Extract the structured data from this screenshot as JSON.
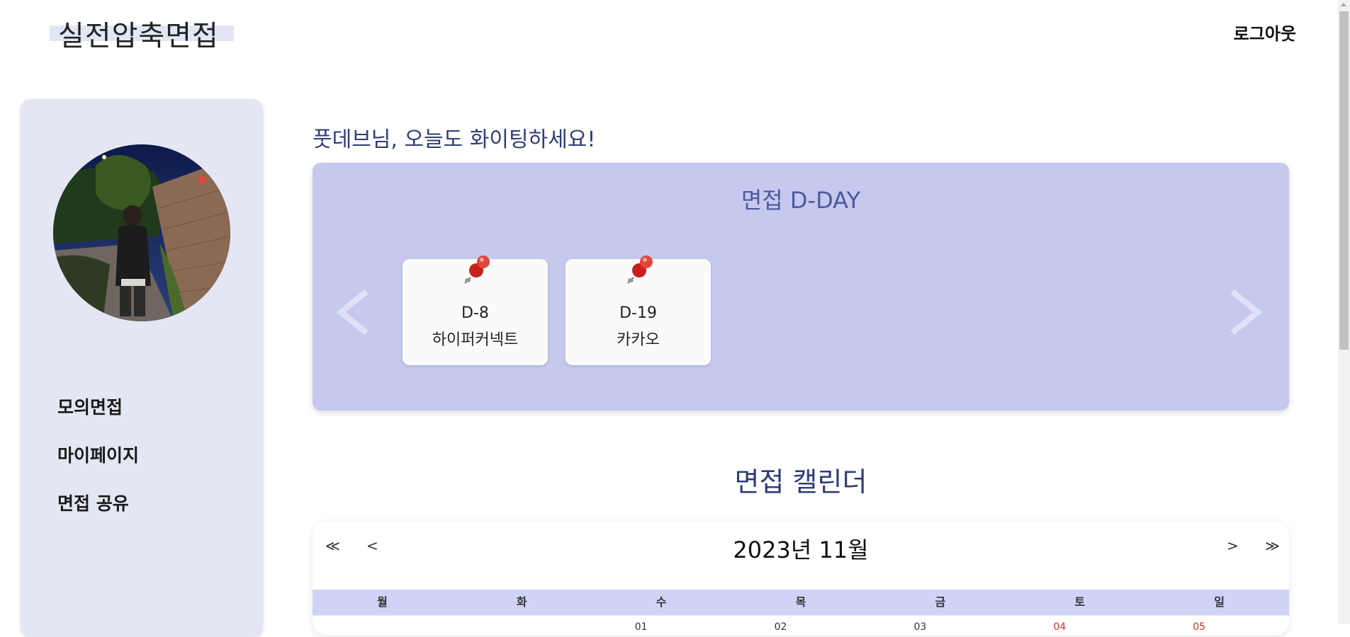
{
  "header": {
    "logo": "실전압축면접",
    "logout": "로그아웃"
  },
  "sidebar": {
    "nav": [
      {
        "label": "모의면접"
      },
      {
        "label": "마이페이지"
      },
      {
        "label": "면접 공유"
      }
    ]
  },
  "main": {
    "greeting": "풋데브님, 오늘도 화이팅하세요!",
    "dday": {
      "title": "면접 D-DAY",
      "cards": [
        {
          "dday": "D-8",
          "company": "하이퍼커넥트"
        },
        {
          "dday": "D-19",
          "company": "카카오"
        }
      ]
    },
    "calendar": {
      "title": "면접 캘린더",
      "month_label": "2023년 11월",
      "nav": {
        "prev_year": "≪",
        "prev_month": "<",
        "next_month": ">",
        "next_year": "≫"
      },
      "weekdays": [
        "월",
        "화",
        "수",
        "목",
        "금",
        "토",
        "일"
      ],
      "first_week": [
        "",
        "",
        "01",
        "02",
        "03",
        "04",
        "05"
      ]
    }
  },
  "colors": {
    "sidebar_bg": "#e4e7f3",
    "dday_bg": "#c6c9ed",
    "weekday_bg": "#cfd3f7",
    "accent_text": "#2e3d78",
    "weekend": "#d0312d"
  },
  "icons": [
    "pushpin-icon",
    "chevron-left-icon",
    "chevron-right-icon"
  ]
}
